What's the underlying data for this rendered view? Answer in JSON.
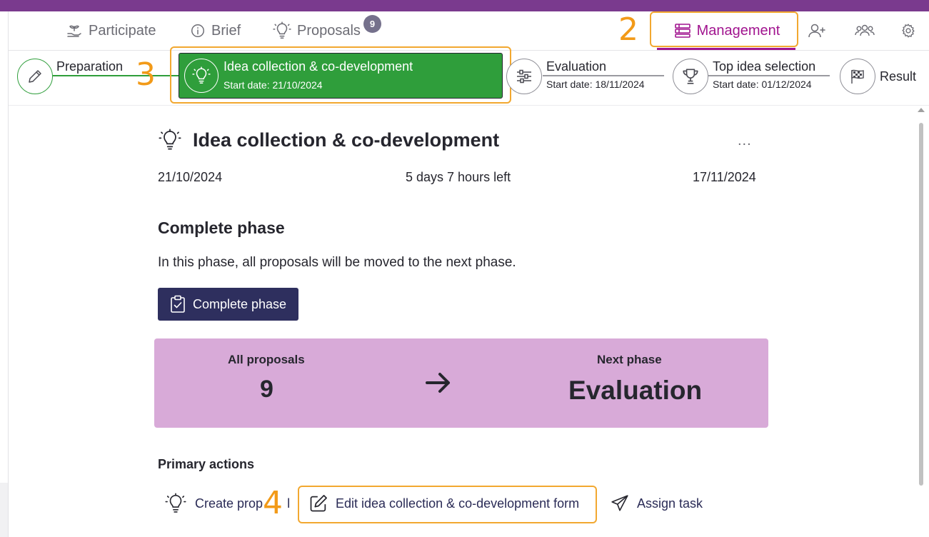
{
  "nav": {
    "tabs": [
      {
        "label": "Participate",
        "icon": "sprout-hand-icon"
      },
      {
        "label": "Brief",
        "icon": "info-icon"
      },
      {
        "label": "Proposals",
        "icon": "lightbulb-icon",
        "badge": "9"
      },
      {
        "label": "Management",
        "icon": "layout-list-icon",
        "active": true
      }
    ],
    "icons": [
      "add-user-icon",
      "group-icon",
      "settings-gear-icon"
    ]
  },
  "annotations": {
    "n2": "2",
    "n3": "3",
    "n4": "4",
    "color": "#f2a830"
  },
  "phases": [
    {
      "label": "Preparation",
      "date": "",
      "icon": "pencil-icon",
      "status": "done"
    },
    {
      "label": "Idea collection & co-development",
      "date": "Start date: 21/10/2024",
      "icon": "lightbulb-icon",
      "status": "active"
    },
    {
      "label": "Evaluation",
      "date": "Start date: 18/11/2024",
      "icon": "sliders-icon",
      "status": "upcoming"
    },
    {
      "label": "Top idea selection",
      "date": "Start date: 01/12/2024",
      "icon": "trophy-icon",
      "status": "upcoming"
    },
    {
      "label": "Result",
      "date": "",
      "icon": "checkered-flag-icon",
      "status": "upcoming"
    }
  ],
  "main": {
    "title": "Idea collection & co-development",
    "more": "...",
    "start_date": "21/10/2024",
    "time_left": "5 days 7 hours left",
    "end_date": "17/11/2024",
    "section_title": "Complete phase",
    "description": "In this phase, all proposals will be moved to the next phase.",
    "complete_button": "Complete phase"
  },
  "summary": {
    "all_label": "All proposals",
    "all_value": "9",
    "next_label": "Next phase",
    "next_value": "Evaluation",
    "background": "#d8aad8"
  },
  "primary_actions": {
    "heading": "Primary actions",
    "create": "Create prop",
    "create_tail": "l",
    "edit": "Edit idea collection & co-development form",
    "assign": "Assign task"
  },
  "colors": {
    "brand_purple": "#7a3a8e",
    "management_magenta": "#a1148f",
    "active_green": "#2f9e3b",
    "button_navy": "#2e2f5e"
  }
}
